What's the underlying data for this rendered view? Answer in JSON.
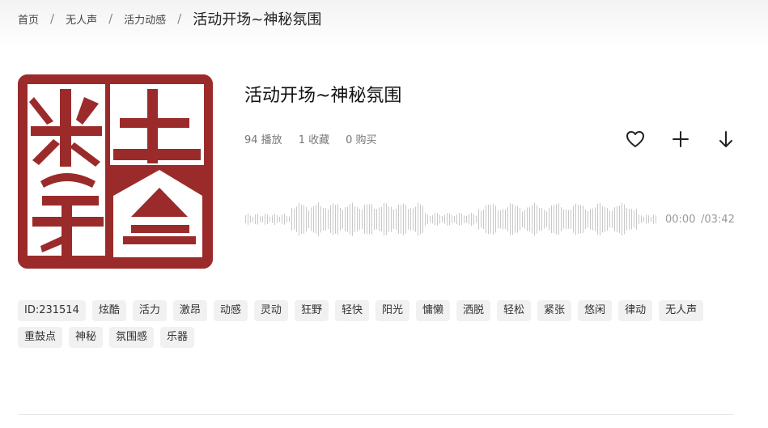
{
  "breadcrumb": {
    "items": [
      "首页",
      "无人声",
      "活力动感"
    ],
    "separator": "/",
    "current": "活动开场~神秘氛围"
  },
  "track": {
    "title": "活动开场~神秘氛围",
    "stats": {
      "plays": "94 播放",
      "favorites": "1 收藏",
      "purchases": "0 购买"
    },
    "actions": [
      "heart-icon",
      "plus-icon",
      "download-arrow-icon"
    ],
    "player": {
      "current_time": "00:00",
      "total_time": "/03:42",
      "progress": 0
    },
    "cover": {
      "colors": {
        "seal_red": "#9b2b2b",
        "paper": "#ffffff"
      }
    }
  },
  "tags": [
    "ID:231514",
    "炫酷",
    "活力",
    "激昂",
    "动感",
    "灵动",
    "狂野",
    "轻快",
    "阳光",
    "慵懒",
    "洒脱",
    "轻松",
    "紧张",
    "悠闲",
    "律动",
    "无人声",
    "重鼓点",
    "神秘",
    "氛围感",
    "乐器"
  ],
  "colors": {
    "accent": "#222222",
    "muted": "#777777",
    "tag_bg": "#f1f1f1",
    "waveform": "#c8c8c8"
  }
}
